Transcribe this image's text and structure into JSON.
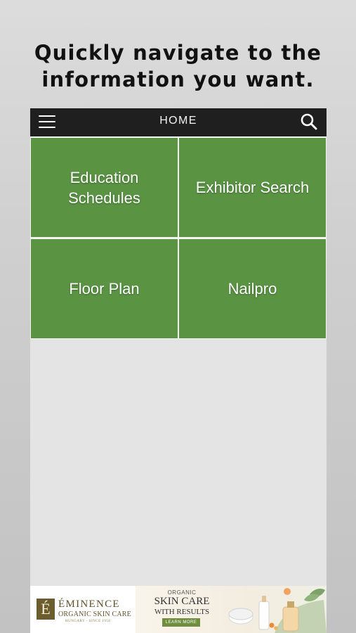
{
  "promo": {
    "line1": "Quickly navigate to the",
    "line2": "information you want."
  },
  "navbar": {
    "title": "HOME",
    "menu_icon": "hamburger-menu-icon",
    "search_icon": "search-icon",
    "background": "#1f1f1f"
  },
  "tiles": [
    {
      "label": "Education\nSchedules"
    },
    {
      "label": "Exhibitor Search"
    },
    {
      "label": "Floor Plan"
    },
    {
      "label": "Nailpro"
    }
  ],
  "tile_color": "#5a9443",
  "ad": {
    "logo_letter": "É",
    "brand": "ÉMINENCE",
    "brand_sub": "ORGANIC SKIN CARE",
    "brand_tag": "HUNGARY · SINCE 1958",
    "organic": "ORGANIC",
    "headline": "SKIN CARE",
    "subheadline": "WITH RESULTS",
    "cta": "LEARN MORE"
  }
}
